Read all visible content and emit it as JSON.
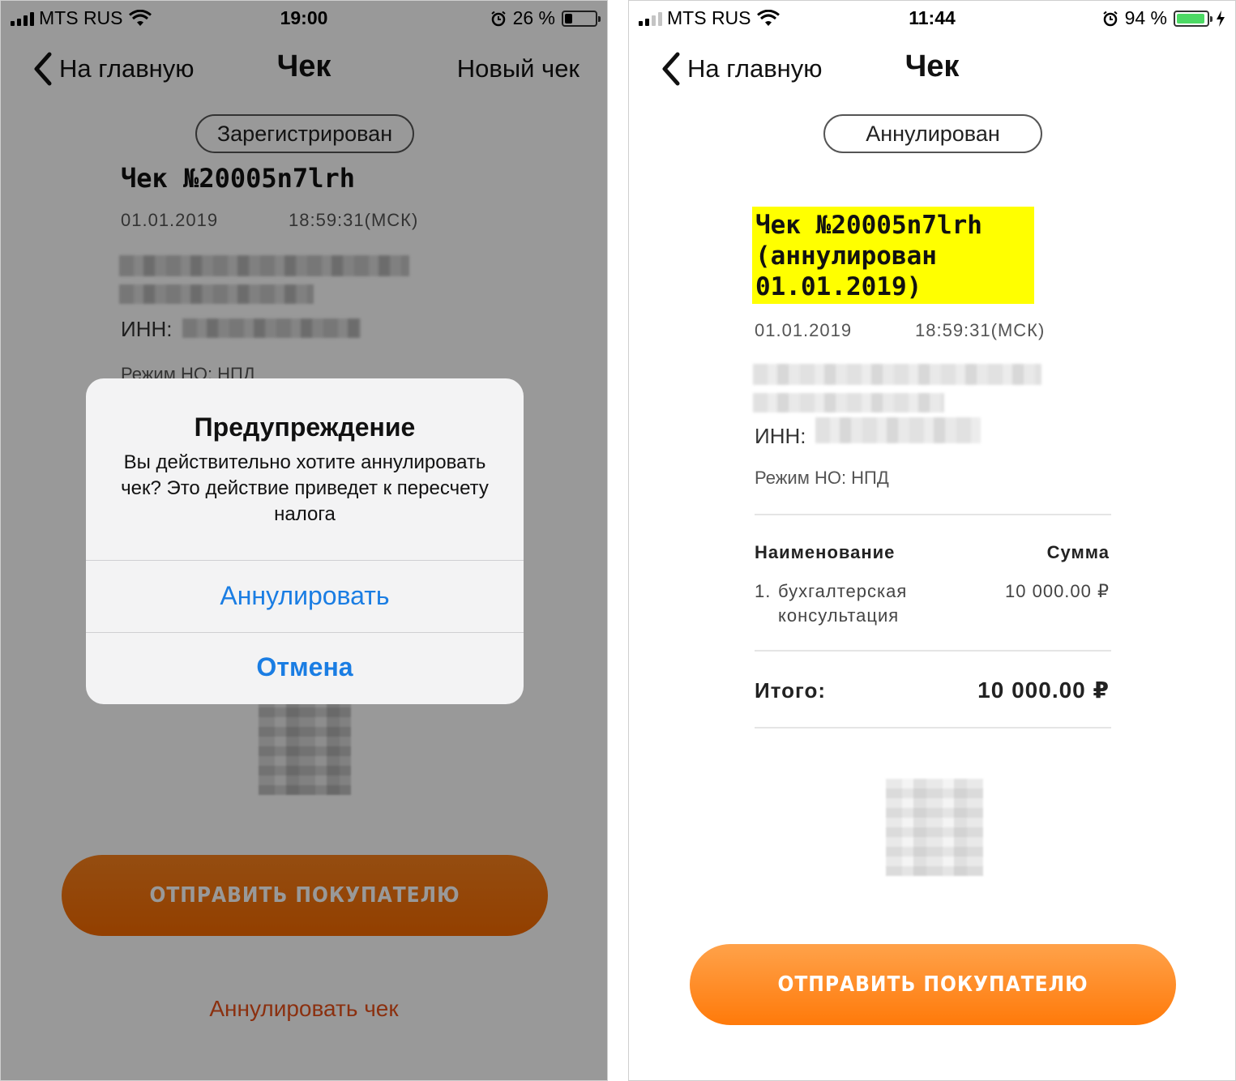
{
  "left": {
    "status": {
      "carrier": "MTS RUS",
      "time": "19:00",
      "battery": "26 %",
      "battery_level": 0.26
    },
    "nav": {
      "back": "На главную",
      "title": "Чек",
      "right": "Новый чек"
    },
    "badge": "Зарегистрирован",
    "receipt_title": "Чек №20005n7lrh",
    "date": "01.01.2019",
    "time": "18:59:31(МСК)",
    "inn_label": "ИНН:",
    "tax_mode": "Режим НО: НПД",
    "send_button": "ОТПРАВИТЬ ПОКУПАТЕЛЮ",
    "cancel_link": "Аннулировать чек",
    "alert": {
      "title": "Предупреждение",
      "message": "Вы действительно хотите аннулировать чек? Это действие приведет к пересчету налога",
      "confirm": "Аннулировать",
      "cancel": "Отмена"
    }
  },
  "right": {
    "status": {
      "carrier": "MTS RUS",
      "time": "11:44",
      "battery": "94 %",
      "battery_level": 0.94
    },
    "nav": {
      "back": "На главную",
      "title": "Чек"
    },
    "badge": "Аннулирован",
    "receipt_title_line1": "Чек №20005n7lrh",
    "receipt_title_line2": "(аннулирован",
    "receipt_title_line3": "01.01.2019)",
    "date": "01.01.2019",
    "time": "18:59:31(МСК)",
    "inn_label": "ИНН:",
    "tax_mode": "Режим НО: НПД",
    "table": {
      "col_name": "Наименование",
      "col_sum": "Сумма",
      "item_num": "1.",
      "item_line1": "бухгалтерская",
      "item_line2": "консультация",
      "item_sum": "10 000.00 ₽"
    },
    "total_label": "Итого:",
    "total_value": "10 000.00 ₽",
    "send_button": "ОТПРАВИТЬ ПОКУПАТЕЛЮ"
  },
  "colors": {
    "accent_orange": "#f77d1a",
    "alert_blue": "#1a7de3",
    "highlight": "#ffff00",
    "battery_green": "#4cd964"
  }
}
